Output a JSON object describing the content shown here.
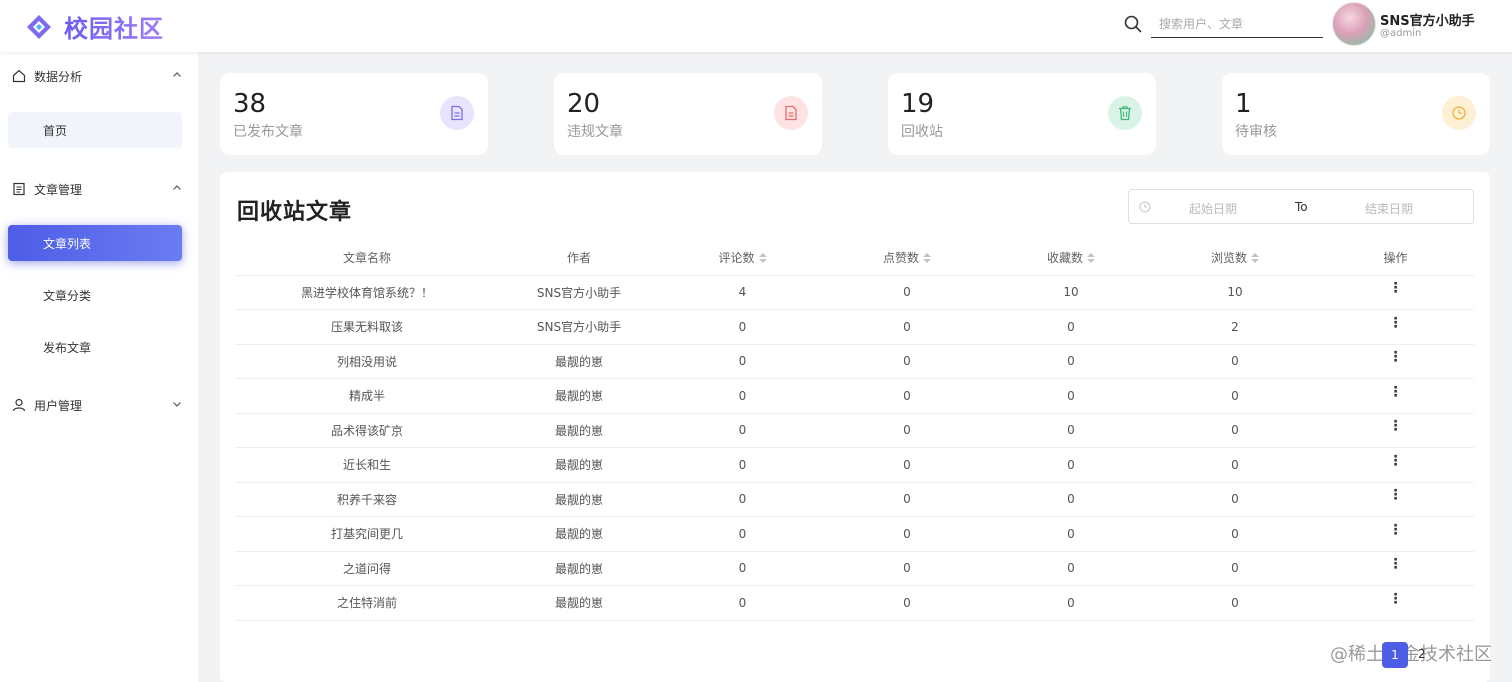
{
  "header": {
    "logo_text": "校园社区",
    "search_placeholder": "搜索用户、文章",
    "user_name": "SNS官方小助手",
    "user_handle": "@admin"
  },
  "sidebar": {
    "groups": [
      {
        "label": "数据分析",
        "icon": "home-icon",
        "expanded": true,
        "items": [
          "首页"
        ]
      },
      {
        "label": "文章管理",
        "icon": "document-icon",
        "expanded": true,
        "items": [
          "文章列表",
          "文章分类",
          "发布文章"
        ]
      },
      {
        "label": "用户管理",
        "icon": "user-icon",
        "expanded": false,
        "items": []
      }
    ],
    "active_item": "文章列表"
  },
  "stats": [
    {
      "value": "38",
      "label": "已发布文章",
      "icon": "document-icon",
      "color": "#7c6cf0",
      "bg": "#e8e4fd"
    },
    {
      "value": "20",
      "label": "违规文章",
      "icon": "document-icon",
      "color": "#ea6b6b",
      "bg": "#fde3e3"
    },
    {
      "value": "19",
      "label": "回收站",
      "icon": "trash-icon",
      "color": "#3cb97a",
      "bg": "#d9f4e6"
    },
    {
      "value": "1",
      "label": "待审核",
      "icon": "clock-icon",
      "color": "#f0b23c",
      "bg": "#fdf0d4"
    }
  ],
  "panel": {
    "title": "回收站文章",
    "date_start_placeholder": "起始日期",
    "date_separator": "To",
    "date_end_placeholder": "结束日期"
  },
  "table": {
    "columns": [
      "文章名称",
      "作者",
      "评论数",
      "点赞数",
      "收藏数",
      "浏览数",
      "操作"
    ],
    "rows": [
      {
        "title": "黑进学校体育馆系统？！",
        "author": "SNS官方小助手",
        "comments": "4",
        "likes": "0",
        "favorites": "10",
        "views": "10"
      },
      {
        "title": "压果无料取该",
        "author": "SNS官方小助手",
        "comments": "0",
        "likes": "0",
        "favorites": "0",
        "views": "2"
      },
      {
        "title": "列相没用说",
        "author": "最靓的崽",
        "comments": "0",
        "likes": "0",
        "favorites": "0",
        "views": "0"
      },
      {
        "title": "精成半",
        "author": "最靓的崽",
        "comments": "0",
        "likes": "0",
        "favorites": "0",
        "views": "0"
      },
      {
        "title": "品术得该矿京",
        "author": "最靓的崽",
        "comments": "0",
        "likes": "0",
        "favorites": "0",
        "views": "0"
      },
      {
        "title": "近长和生",
        "author": "最靓的崽",
        "comments": "0",
        "likes": "0",
        "favorites": "0",
        "views": "0"
      },
      {
        "title": "积养千来容",
        "author": "最靓的崽",
        "comments": "0",
        "likes": "0",
        "favorites": "0",
        "views": "0"
      },
      {
        "title": "打基究间更几",
        "author": "最靓的崽",
        "comments": "0",
        "likes": "0",
        "favorites": "0",
        "views": "0"
      },
      {
        "title": "之道问得",
        "author": "最靓的崽",
        "comments": "0",
        "likes": "0",
        "favorites": "0",
        "views": "0"
      },
      {
        "title": "之住特消前",
        "author": "最靓的崽",
        "comments": "0",
        "likes": "0",
        "favorites": "0",
        "views": "0"
      }
    ],
    "more_glyph": "⋮"
  },
  "pagination": {
    "current": "1",
    "next": "2"
  },
  "watermark": "@稀土掘金技术社区"
}
